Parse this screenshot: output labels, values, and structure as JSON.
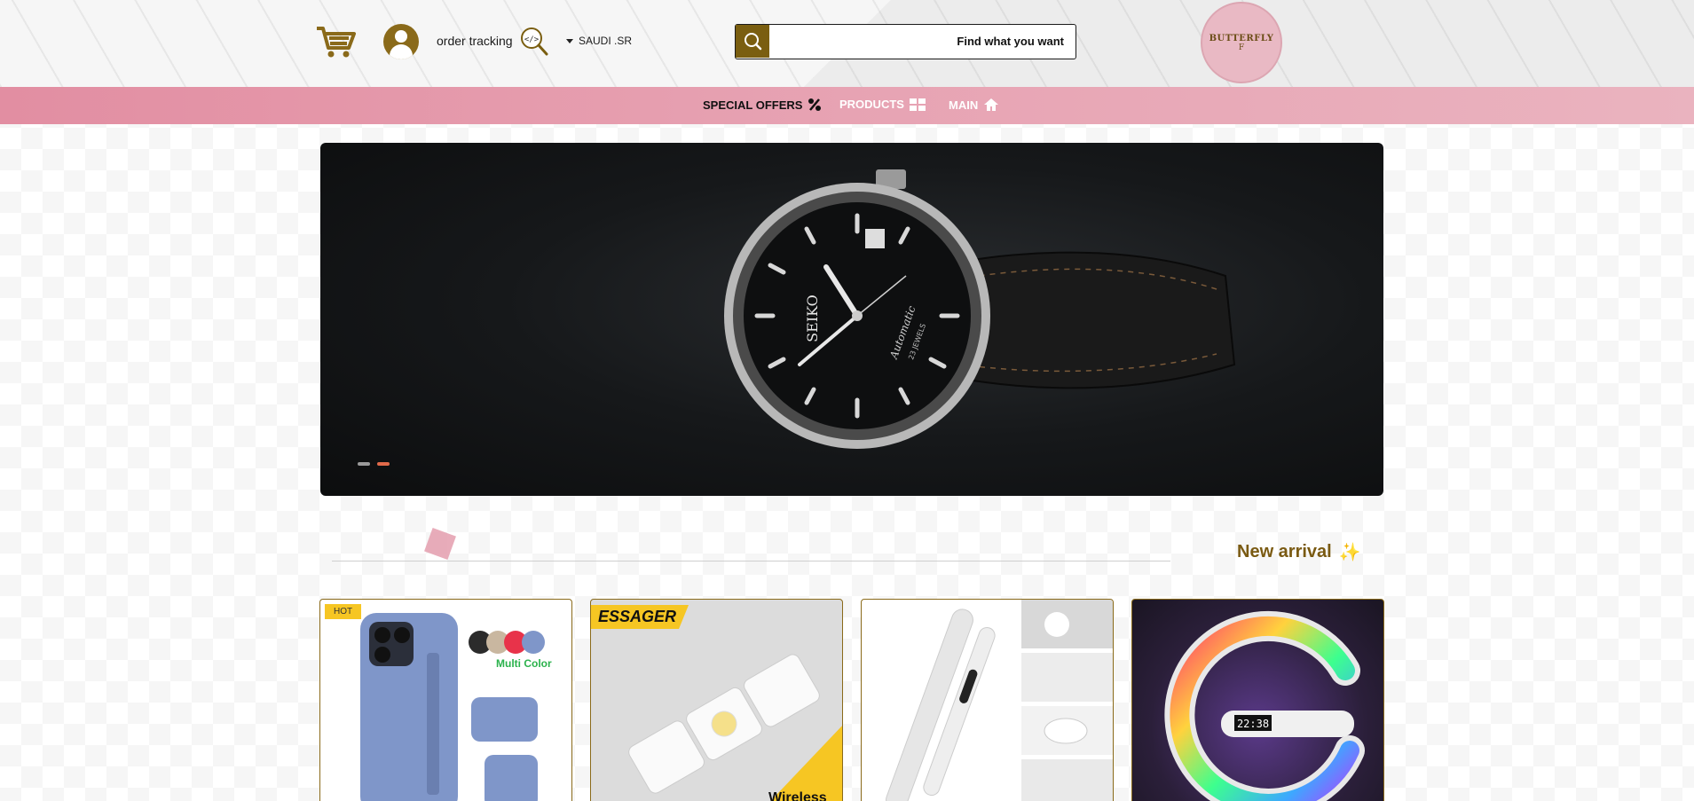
{
  "header": {
    "order_tracking": "order tracking",
    "currency": "SAUDI .SR",
    "search_placeholder": "Find what you want",
    "logo_text": "BUTTERFLY",
    "logo_sub": "F"
  },
  "nav": {
    "special_offers": "SPECIAL OFFERS",
    "products": "PRODUCTS",
    "main": "MAIN"
  },
  "banner": {
    "watch_brand": "SEIKO",
    "watch_model": "Automatic",
    "watch_jewels": "23 JEWELS",
    "slides_count": 2,
    "active_slide": 2
  },
  "section": {
    "title": "New arrival"
  },
  "products": [
    {
      "badge": "HOT",
      "label": "Multi Color"
    },
    {
      "badge": "ESSAGER",
      "label": "Wireless"
    },
    {
      "badge": "",
      "label": ""
    },
    {
      "badge": "",
      "label": "22:38"
    }
  ],
  "colors": {
    "accent": "#7a5e10",
    "nav_pink": "#e28ea2",
    "badge_yellow": "#f6c623",
    "dot_active": "#e06a4a"
  }
}
